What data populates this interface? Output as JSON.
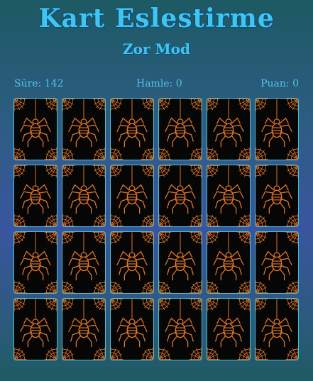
{
  "game": {
    "title": "Kart Eslestirme",
    "mode": "Zor Mod"
  },
  "stats": {
    "time_label": "Süre",
    "time_value": "142",
    "moves_label": "Hamle",
    "moves_value": "0",
    "score_label": "Puan",
    "score_value": "0"
  },
  "board": {
    "rows": 4,
    "columns": 6,
    "card_back_icon": "spider-web-icon",
    "card_face_state": "hidden"
  },
  "colors": {
    "title": "#3ec6f2",
    "card_border": "#45c6d2",
    "card_back": "#060606",
    "spider_orange": "#e8782a"
  }
}
